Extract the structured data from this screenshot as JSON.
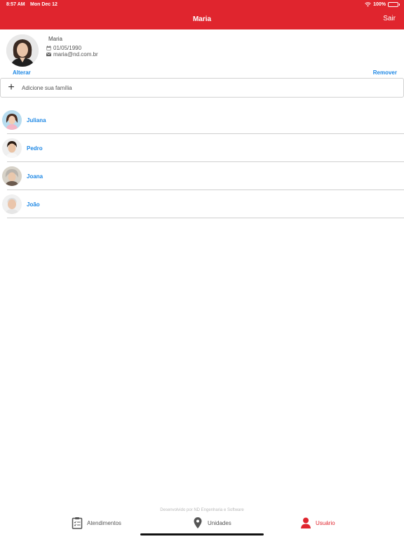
{
  "status_bar": {
    "time": "8:57 AM",
    "date": "Mon Dec 12",
    "battery": "100%"
  },
  "nav": {
    "title": "Maria",
    "action_label": "Sair"
  },
  "profile": {
    "name": "Maria",
    "birthdate": "01/05/1990",
    "email": "maria@nd.com.br",
    "edit_label": "Alterar",
    "remove_label": "Remover"
  },
  "add_family": {
    "label": "Adicione sua família"
  },
  "family": [
    {
      "name": "Juliana"
    },
    {
      "name": "Pedro"
    },
    {
      "name": "Joana"
    },
    {
      "name": "João"
    }
  ],
  "footer": {
    "credit": "Desenvolvido por ND Engenharia e Software"
  },
  "tabs": [
    {
      "label": "Atendimentos",
      "icon": "clipboard-icon"
    },
    {
      "label": "Unidades",
      "icon": "map-pin-icon"
    },
    {
      "label": "Usuário",
      "icon": "user-icon",
      "active": true
    }
  ],
  "colors": {
    "brand_red": "#e0252e",
    "link_blue": "#1e88e5"
  }
}
